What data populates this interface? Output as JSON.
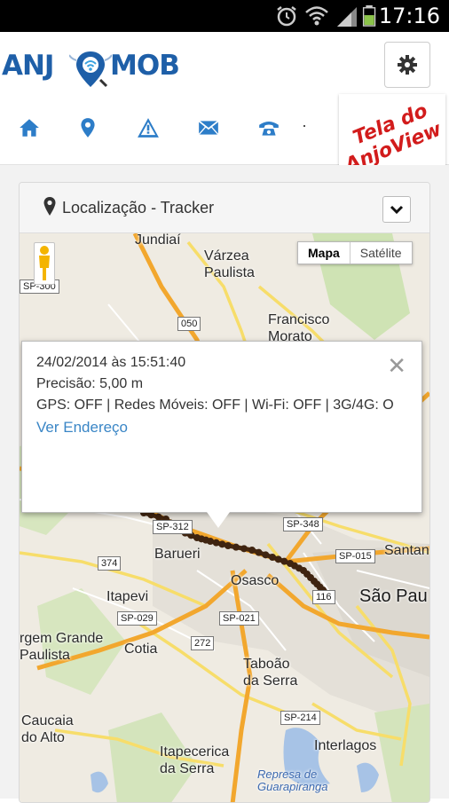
{
  "status_bar": {
    "time": "17:16",
    "icons": [
      "alarm-icon",
      "wifi-icon",
      "signal-icon",
      "battery-icon"
    ]
  },
  "header": {
    "logo_text_left": "ANJ",
    "logo_text_right": "MOB",
    "settings_icon": "gear-icon",
    "nav_icons": [
      "home-icon",
      "location-pin-icon",
      "warning-icon",
      "envelope-icon",
      "phone-icon"
    ],
    "nav_separator": "·",
    "badge_line1": "Tela do",
    "badge_line2": "AnjoView"
  },
  "panel": {
    "title": "Localização -  Tracker",
    "collapse_icon": "chevron-down-icon"
  },
  "map": {
    "type_buttons": {
      "map": "Mapa",
      "satellite": "Satélite"
    },
    "places": {
      "jundiai": "Jundiaí",
      "varzea": "Várzea\nPaulista",
      "francisco": "Francisco\nMorato",
      "barueri": "Barueri",
      "osasco": "Osasco",
      "sao_paulo": "São Pau",
      "itapevi": "Itapevi",
      "cotia": "Cotia",
      "vargem": "rgem Grande\nPaulista",
      "taboao": "Taboão\nda Serra",
      "caucaia": "Caucaia\ndo Alto",
      "itapecerica": "Itapecerica\nda Serra",
      "interlagos": "Interlagos",
      "santana": "Santan",
      "represa": "Represa de\nGuarapiranga"
    },
    "shields": {
      "sp300": "SP-300",
      "r050": "050",
      "sp312": "SP-312",
      "sp348": "SP-348",
      "sp015": "SP-015",
      "r374": "374",
      "sp029": "SP-029",
      "sp021": "SP-021",
      "r272": "272",
      "sp214": "SP-214",
      "r116": "116"
    },
    "info_window": {
      "datetime": "24/02/2014 às 15:51:40",
      "precision": "Precisão: 5,00 m",
      "status": "GPS: OFF | Redes Móveis: OFF | Wi-Fi: OFF | 3G/4G: O",
      "link": "Ver Endereço",
      "close": "✕"
    }
  },
  "colors": {
    "brand_blue": "#1e5fa8",
    "badge_red": "#d21c1c",
    "track": "#4a2a10",
    "road_orange": "#f2a72e",
    "road_yellow": "#f7dd6a"
  }
}
